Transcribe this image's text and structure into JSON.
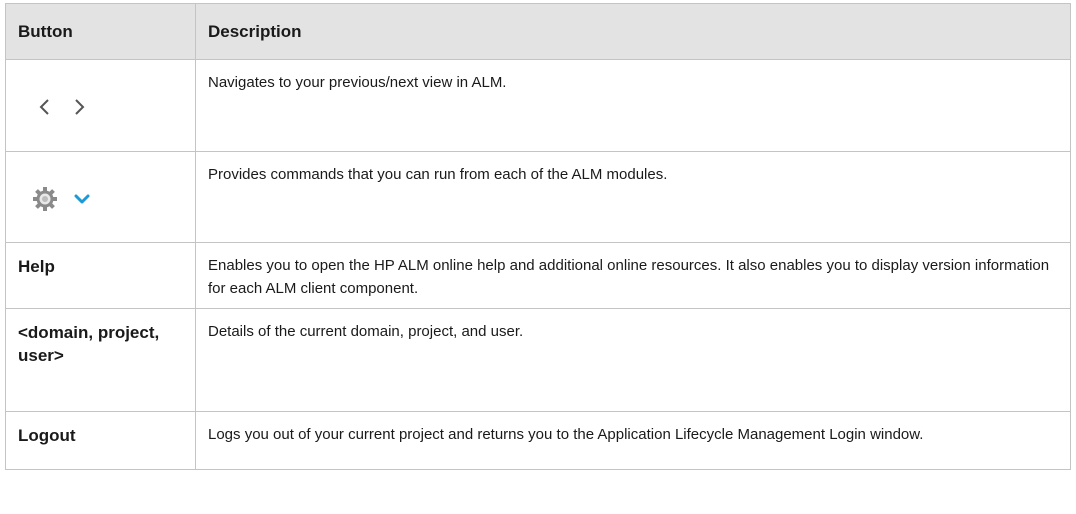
{
  "table": {
    "headers": {
      "button": "Button",
      "description": "Description"
    },
    "rows": [
      {
        "button": "",
        "icons": [
          "chevron-left-icon",
          "chevron-right-icon"
        ],
        "description": "Navigates to your previous/next view in ALM."
      },
      {
        "button": "",
        "icons": [
          "gear-icon",
          "chevron-down-icon"
        ],
        "description": "Provides commands that you can run from each of the ALM modules."
      },
      {
        "button": "Help",
        "description": "Enables you to open the HP ALM online help and additional online resources. It also enables you to display version information for each ALM client component."
      },
      {
        "button": "<domain, project, user>",
        "description": "Details of the current domain, project, and user."
      },
      {
        "button": "Logout",
        "description": "Logs you out of your current project and returns you to the Application Lifecycle Management Login window."
      }
    ]
  },
  "colors": {
    "header_bg": "#e3e3e3",
    "border": "#c4c4c4",
    "accent_chevron": "#1a9ad6",
    "gear": "#8a8a8a"
  }
}
